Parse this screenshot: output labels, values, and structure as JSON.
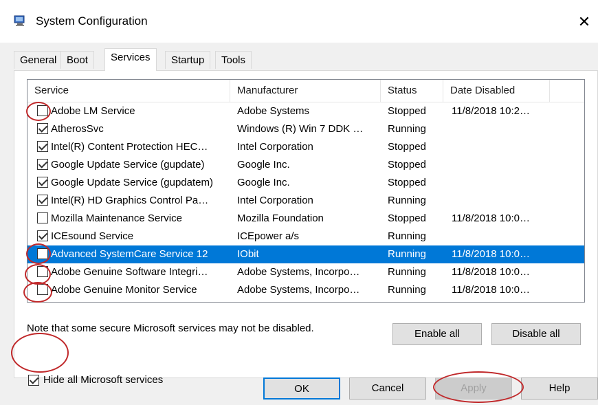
{
  "window": {
    "title": "System Configuration",
    "close_glyph": "✕",
    "icon": "msconfig-icon"
  },
  "tabs": [
    {
      "label": "General",
      "active": false
    },
    {
      "label": "Boot",
      "active": false
    },
    {
      "label": "Services",
      "active": true
    },
    {
      "label": "Startup",
      "active": false
    },
    {
      "label": "Tools",
      "active": false
    }
  ],
  "columns": [
    "Service",
    "Manufacturer",
    "Status",
    "Date Disabled"
  ],
  "rows": [
    {
      "checked": false,
      "service": "Adobe LM Service",
      "manufacturer": "Adobe Systems",
      "status": "Stopped",
      "date": "11/8/2018 10:2…",
      "selected": false
    },
    {
      "checked": true,
      "service": "AtherosSvc",
      "manufacturer": "Windows (R) Win 7 DDK …",
      "status": "Running",
      "date": "",
      "selected": false
    },
    {
      "checked": true,
      "service": "Intel(R) Content Protection HEC…",
      "manufacturer": "Intel Corporation",
      "status": "Stopped",
      "date": "",
      "selected": false
    },
    {
      "checked": true,
      "service": "Google Update Service (gupdate)",
      "manufacturer": "Google Inc.",
      "status": "Stopped",
      "date": "",
      "selected": false
    },
    {
      "checked": true,
      "service": "Google Update Service (gupdatem)",
      "manufacturer": "Google Inc.",
      "status": "Stopped",
      "date": "",
      "selected": false
    },
    {
      "checked": true,
      "service": "Intel(R) HD Graphics Control Pa…",
      "manufacturer": "Intel Corporation",
      "status": "Running",
      "date": "",
      "selected": false
    },
    {
      "checked": false,
      "service": "Mozilla Maintenance Service",
      "manufacturer": "Mozilla Foundation",
      "status": "Stopped",
      "date": "11/8/2018 10:0…",
      "selected": false
    },
    {
      "checked": true,
      "service": "ICEsound Service",
      "manufacturer": "ICEpower a/s",
      "status": "Running",
      "date": "",
      "selected": false
    },
    {
      "checked": false,
      "service": "Advanced SystemCare Service 12",
      "manufacturer": "IObit",
      "status": "Running",
      "date": "11/8/2018 10:0…",
      "selected": true
    },
    {
      "checked": false,
      "service": "Adobe Genuine Software Integri…",
      "manufacturer": "Adobe Systems, Incorpo…",
      "status": "Running",
      "date": "11/8/2018 10:0…",
      "selected": false
    },
    {
      "checked": false,
      "service": "Adobe Genuine Monitor Service",
      "manufacturer": "Adobe Systems, Incorpo…",
      "status": "Running",
      "date": "11/8/2018 10:0…",
      "selected": false
    }
  ],
  "note": "Note that some secure Microsoft services may not be disabled.",
  "enable_all": "Enable all",
  "disable_all": "Disable all",
  "hide_ms": {
    "label": "Hide all Microsoft services",
    "checked": true
  },
  "buttons": {
    "ok": "OK",
    "cancel": "Cancel",
    "apply": "Apply",
    "help": "Help"
  },
  "annotation_color": "#c0282a",
  "selection_color": "#0078d7"
}
